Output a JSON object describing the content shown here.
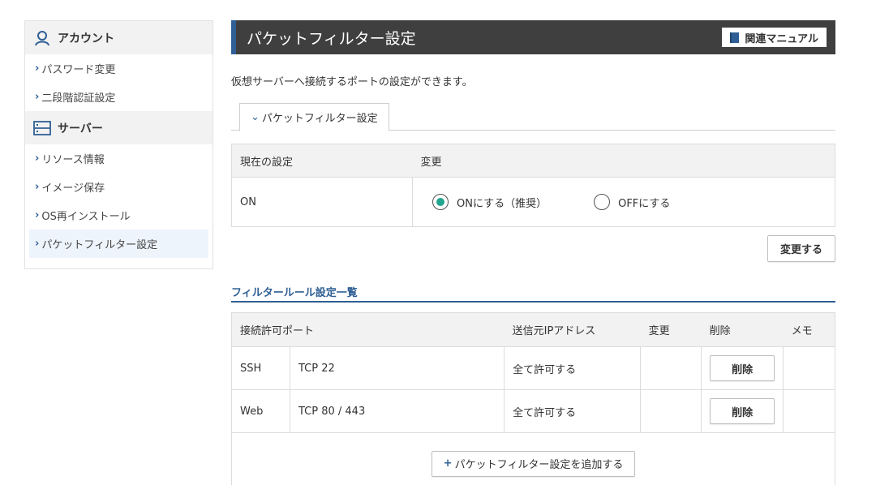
{
  "sidebar": {
    "account_heading": "アカウント",
    "account_items": [
      {
        "label": "パスワード変更"
      },
      {
        "label": "二段階認証設定"
      }
    ],
    "server_heading": "サーバー",
    "server_items": [
      {
        "label": "リソース情報"
      },
      {
        "label": "イメージ保存"
      },
      {
        "label": "OS再インストール"
      },
      {
        "label": "パケットフィルター設定"
      }
    ]
  },
  "header": {
    "title": "パケットフィルター設定",
    "manual_button": "関連マニュアル"
  },
  "description": "仮想サーバーへ接続するポートの設定ができます。",
  "tab_label": "パケットフィルター設定",
  "setting": {
    "col_current": "現在の設定",
    "col_change": "変更",
    "current_value": "ON",
    "option_on": "ONにする（推奨）",
    "option_off": "OFFにする",
    "selected": "on",
    "change_button": "変更する"
  },
  "rules": {
    "section_title": "フィルタールール設定一覧",
    "headers": {
      "port": "接続許可ポート",
      "source": "送信元IPアドレス",
      "change": "変更",
      "delete": "削除",
      "memo": "メモ"
    },
    "rows": [
      {
        "name": "SSH",
        "port": "TCP 22",
        "source": "全て許可する",
        "delete_label": "削除"
      },
      {
        "name": "Web",
        "port": "TCP 80 / 443",
        "source": "全て許可する",
        "delete_label": "削除"
      }
    ],
    "add_button": "パケットフィルター設定を追加する"
  },
  "colors": {
    "accent": "#2f5f95",
    "header_bg": "#3f3f3f",
    "radio_selected": "#21a58f"
  }
}
